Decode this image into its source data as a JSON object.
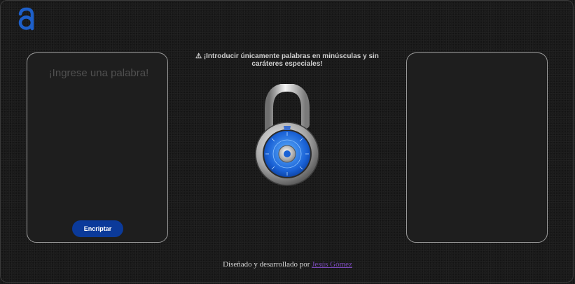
{
  "logo": {
    "icon": "alura-a-logo-icon",
    "color": "#1d5fc9"
  },
  "input_panel": {
    "placeholder": "¡Ingrese una palabra!",
    "value": "",
    "encrypt_button_label": "Encriptar"
  },
  "warning": {
    "icon": "⚠",
    "text": "¡Introducir únicamente palabras en minúsculas y sin caráteres especiales!"
  },
  "lock": {
    "icon": "padlock-icon"
  },
  "output_panel": {
    "value": ""
  },
  "footer": {
    "text": "Diseñado y desarrollado por",
    "author": "Jesús Gómez"
  },
  "colors": {
    "background": "#1a1a1a",
    "button": "#0b3a9a",
    "link": "#7a4ab8",
    "panel_border": "#9a9a9a"
  }
}
